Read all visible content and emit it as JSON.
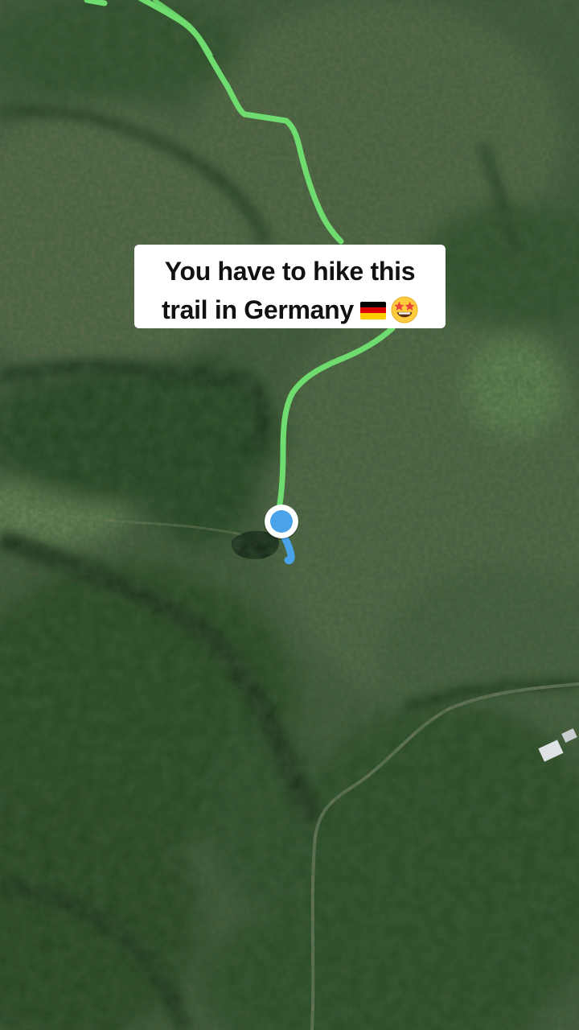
{
  "caption": {
    "line1": "You have to hike this",
    "line2": "trail in Germany",
    "icons": [
      "german-flag-icon",
      "star-struck-emoji-icon"
    ]
  },
  "map": {
    "view": "satellite",
    "trail_color": "#6edc6e",
    "location_marker_color": "#4aa3e8",
    "remaining_trail_color": "#4aa3e8",
    "flag_colors": [
      "#000000",
      "#dd0000",
      "#ffce00"
    ]
  }
}
